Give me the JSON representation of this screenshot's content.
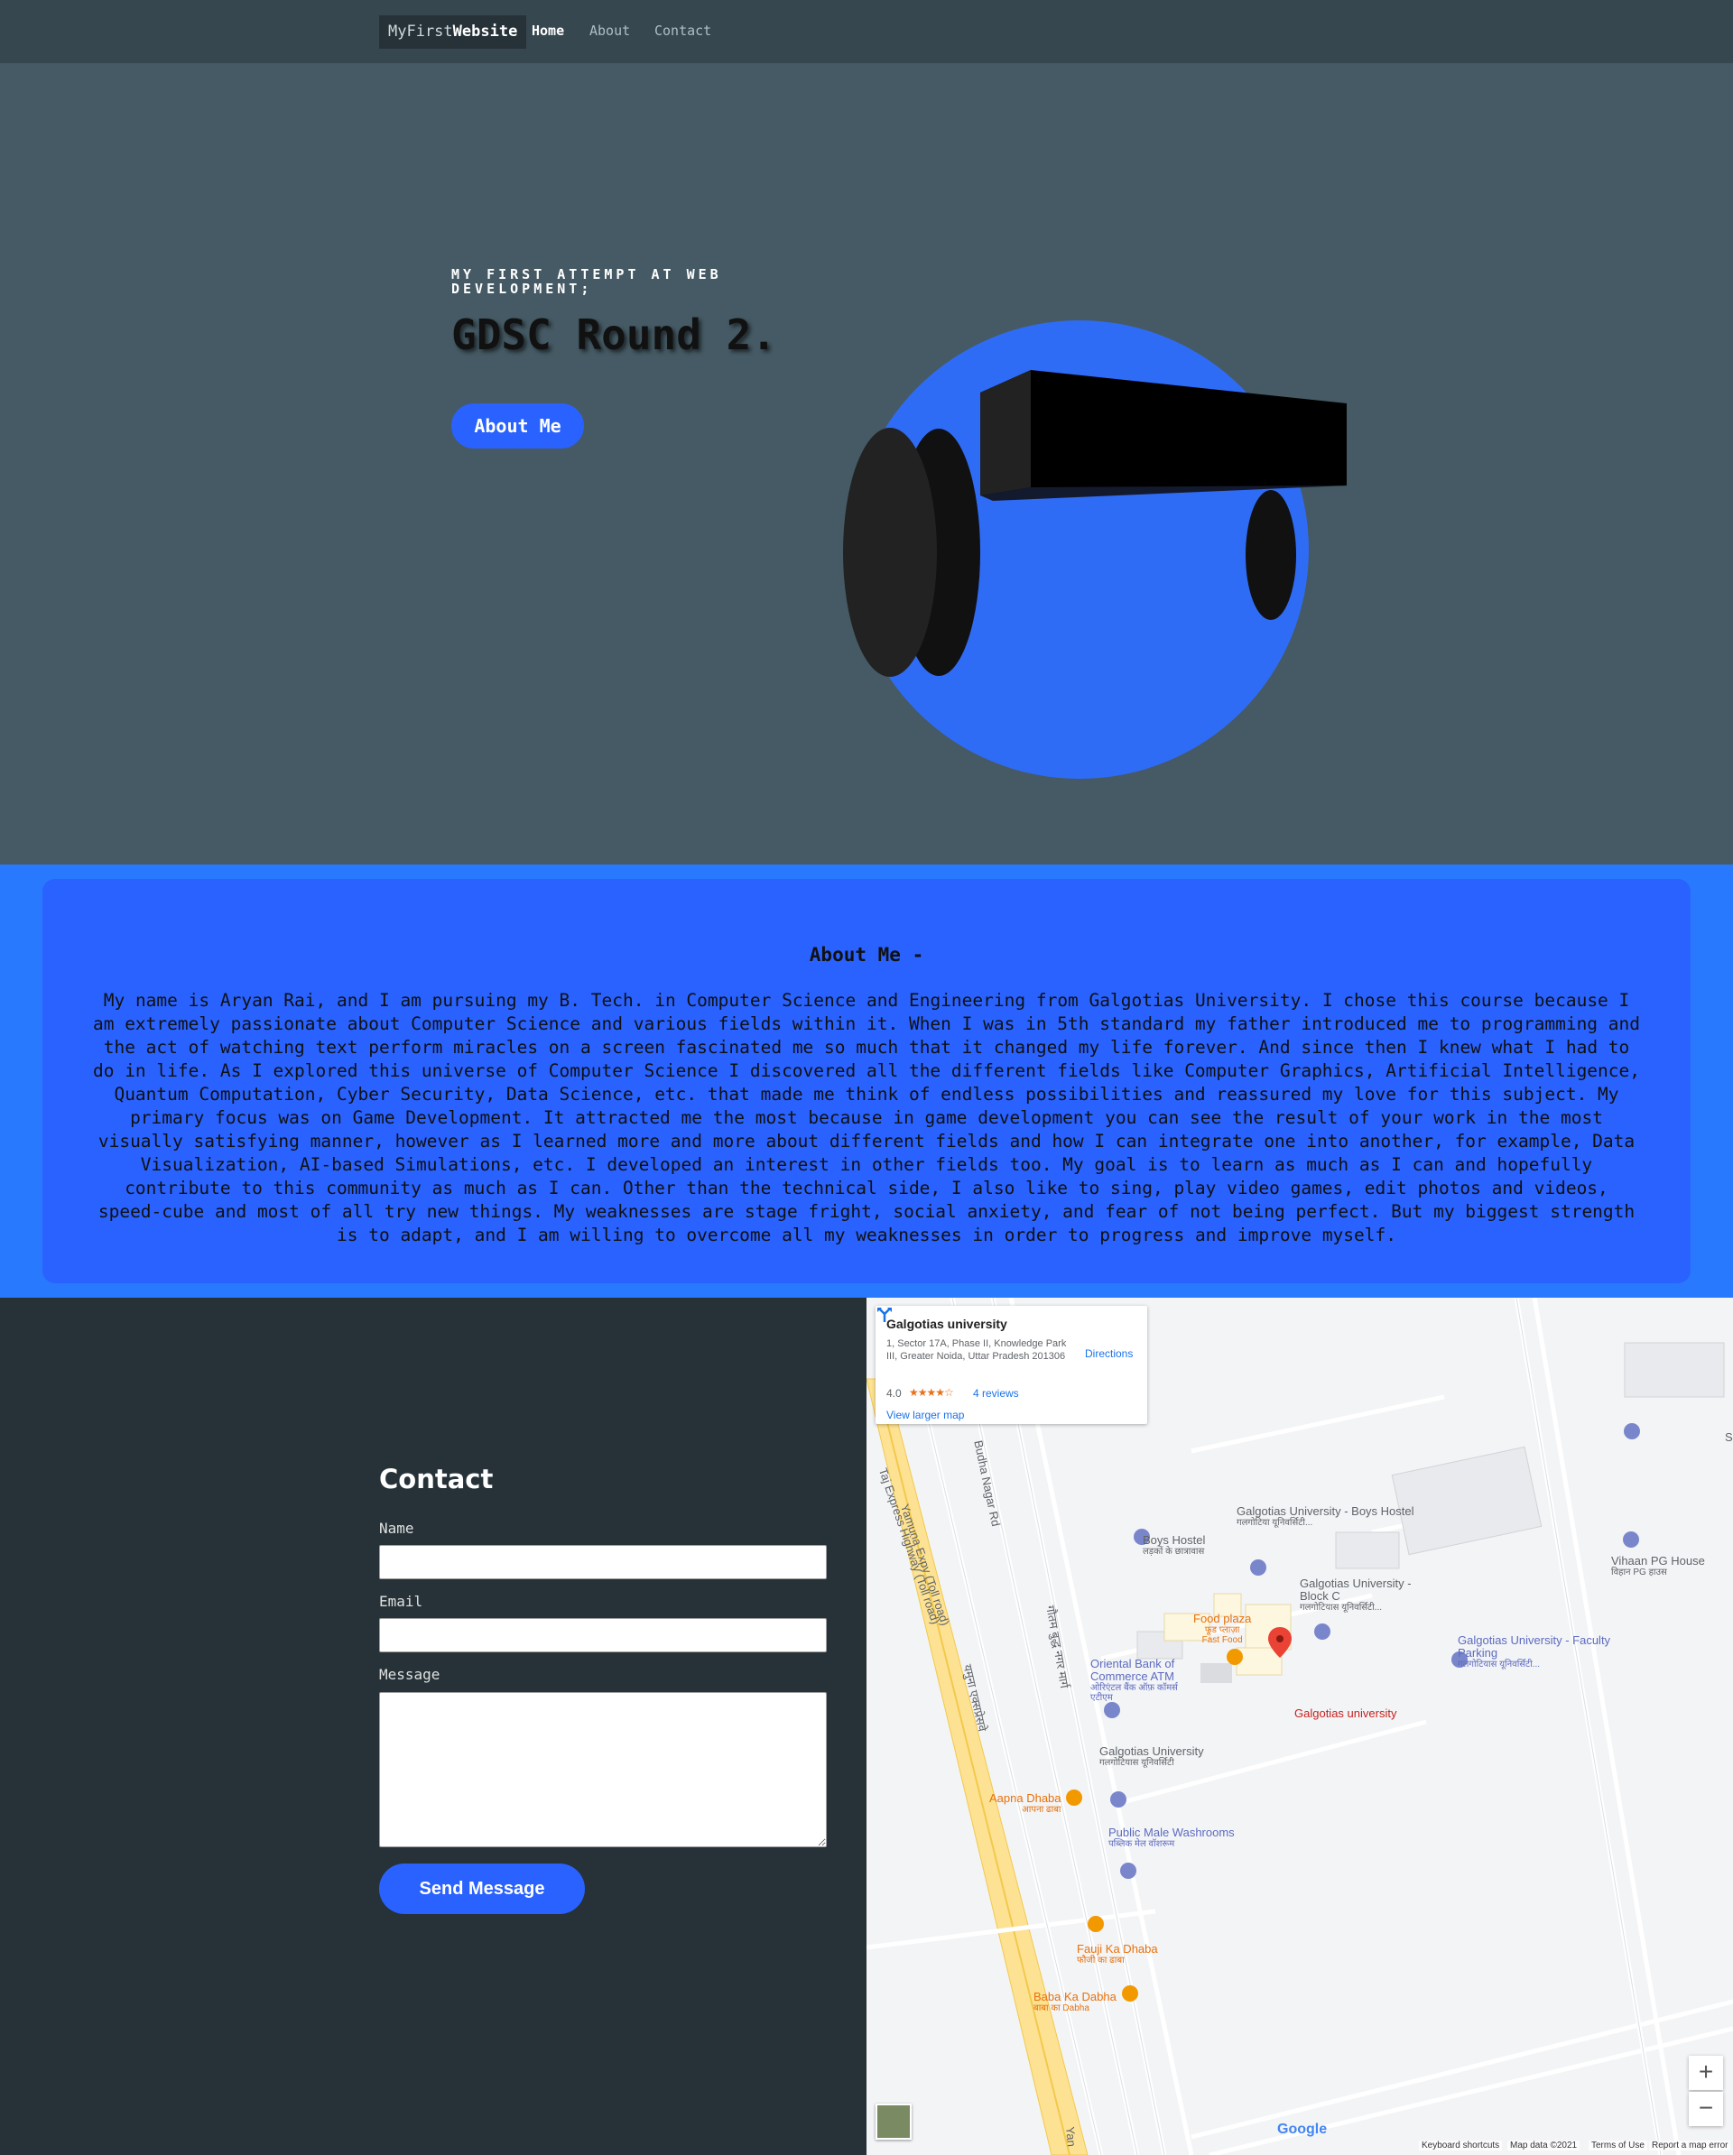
{
  "nav": {
    "brand_prefix": "MyFirst",
    "brand_bold": "Website",
    "links": [
      "Home",
      "About",
      "Contact"
    ]
  },
  "hero": {
    "eyebrow": "MY FIRST ATTEMPT AT WEB DEVELOPMENT;",
    "title": "GDSC Round 2.",
    "button": "About Me"
  },
  "about": {
    "title": "About Me -",
    "text": "My name is Aryan Rai, and I am pursuing my B. Tech. in Computer Science and Engineering from Galgotias University. I chose this course because I am extremely passionate about Computer Science and various fields within it. When I was in 5th standard my father introduced me to programming and the act of watching text perform miracles on a screen fascinated me so much that it changed my life forever. And since then I knew what I had to do in life. As I explored this universe of Computer Science I discovered all the different fields like Computer Graphics, Artificial Intelligence, Quantum Computation, Cyber Security, Data Science, etc. that made me think of endless possibilities and reassured my love for this subject. My primary focus was on Game Development. It attracted me the most because in game development you can see the result of your work in the most visually satisfying manner, however as I learned more and more about different fields and how I can integrate one into another, for example, Data Visualization, AI-based Simulations, etc. I developed an interest in other fields too. My goal is to learn as much as I can and hopefully contribute to this community as much as I can. Other than the technical side, I also like to sing, play video games, edit photos and videos, speed-cube and most of all try new things. My weaknesses are stage fright, social anxiety, and fear of not being perfect. But my biggest strength is to adapt, and I am willing to overcome all my weaknesses in order to progress and improve myself."
  },
  "contact": {
    "title": "Contact",
    "name_label": "Name",
    "email_label": "Email",
    "message_label": "Message",
    "name_value": "",
    "email_value": "",
    "message_value": "",
    "send_button": "Send Message"
  },
  "map": {
    "place_name": "Galgotias university",
    "address": "1, Sector 17A, Phase II, Knowledge Park III, Greater Noida, Uttar Pradesh 201306",
    "rating": "4.0",
    "stars": "★★★★☆",
    "reviews": "4 reviews",
    "larger_map": "View larger map",
    "directions": "Directions",
    "labels": {
      "road_budha": "Budha Nagar Rd",
      "road_taj": "Taj Express Highway (Toll road)",
      "road_yamuna": "Yamuna Expy (Toll road)",
      "road_hindi_yamuna": "यमुना एक्सप्रेसवे",
      "road_hindi_gautam": "गौतम बुद्ध नगर मार्ग",
      "road_edge": "Yan",
      "boys_hostel_gu": "Galgotias University - Boys Hostel",
      "boys_hostel_gu_hi": "गलगोटिया यूनिवर्सिटी...",
      "boys_hostel": "Boys Hostel",
      "boys_hostel_hi": "लड़कों के छात्रावास",
      "block_c": "Galgotias University - Block C",
      "block_c_hi": "गलगोटियास यूनिवर्सिटी...",
      "vihaan": "Vihaan PG House",
      "vihaan_hi": "विहान PG हाउस",
      "food_plaza": "Food plaza",
      "food_plaza_hi": "फूड प्लाज़ा",
      "fast_food": "Fast Food",
      "faculty_parking": "Galgotias University - Faculty Parking",
      "faculty_parking_hi": "गलगोटियास यूनिवर्सिटी...",
      "obc_atm": "Oriental Bank of Commerce ATM",
      "obc_atm_hi": "ओरिएंटल बैंक ऑफ़ कॉमर्स एटीएम",
      "gu_pin": "Galgotias university",
      "gu_main": "Galgotias University",
      "gu_main_hi": "गलगोटियास यूनिवर्सिटी",
      "aapna_dhaba": "Aapna Dhaba",
      "aapna_dhaba_hi": "आपना ढाबा",
      "washrooms": "Public Male Washrooms",
      "washrooms_hi": "पब्लिक मेल वॉशरूम",
      "fauji_dhaba": "Fauji Ka Dhaba",
      "fauji_dhaba_hi": "फौजी का ढाबा",
      "baba_dhaba": "Baba Ka Dabha",
      "baba_dhaba_hi": "बाबा का Dabha",
      "edge_s": "S"
    },
    "zoom_in": "+",
    "zoom_out": "−",
    "google": "Google",
    "footer": [
      "Keyboard shortcuts",
      "Map data ©2021",
      "Terms of Use",
      "Report a map error"
    ]
  },
  "colors": {
    "accent": "#2962ff",
    "hero_bg": "#455a64",
    "nav_bg": "#37474f",
    "contact_bg": "#263238"
  }
}
